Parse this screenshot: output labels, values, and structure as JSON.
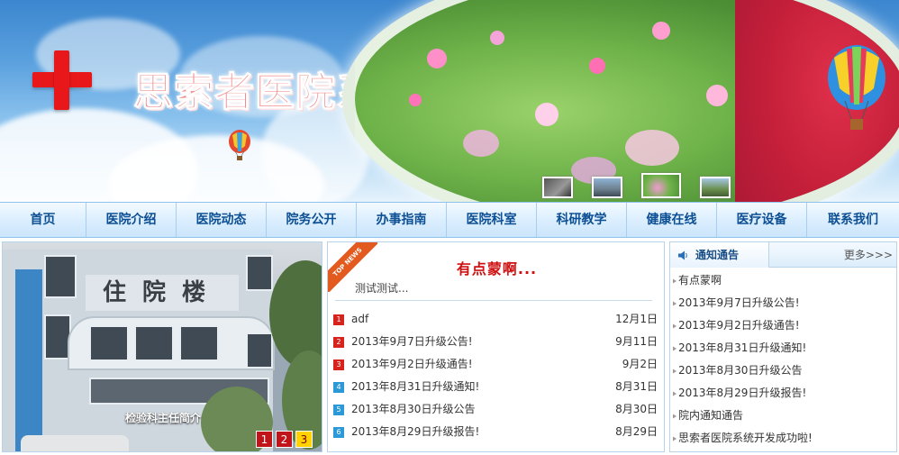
{
  "header": {
    "site_title": "思索者医院系统"
  },
  "nav": {
    "items": [
      "首页",
      "医院介绍",
      "医院动态",
      "院务公开",
      "办事指南",
      "医院科室",
      "科研教学",
      "健康在线",
      "医疗设备",
      "联系我们"
    ]
  },
  "slideshow": {
    "sign_text": "住院楼",
    "caption": "检验科主任简介",
    "pages": [
      "1",
      "2",
      "3"
    ],
    "active_page": 3
  },
  "news": {
    "badge": "TOP NEWS",
    "headline": "有点蒙啊...",
    "summary": "测试测试...",
    "items": [
      {
        "num": "1",
        "title": "adf",
        "date": "12月1日",
        "color": "red"
      },
      {
        "num": "2",
        "title": "2013年9月7日升级公告!",
        "date": "9月11日",
        "color": "red"
      },
      {
        "num": "3",
        "title": "2013年9月2日升级通告!",
        "date": "9月2日",
        "color": "red"
      },
      {
        "num": "4",
        "title": "2013年8月31日升级通知!",
        "date": "8月31日",
        "color": "blue"
      },
      {
        "num": "5",
        "title": "2013年8月30日升级公告",
        "date": "8月30日",
        "color": "blue"
      },
      {
        "num": "6",
        "title": "2013年8月29日升级报告!",
        "date": "8月29日",
        "color": "blue"
      }
    ]
  },
  "notices": {
    "title": "通知通告",
    "more": "更多>>>",
    "items": [
      "有点蒙啊",
      "2013年9月7日升级公告!",
      "2013年9月2日升级通告!",
      "2013年8月31日升级通知!",
      "2013年8月30日升级公告",
      "2013年8月29日升级报告!",
      "院内通知通告",
      "思索者医院系统开发成功啦!"
    ]
  },
  "colors": {
    "brand_red": "#e8171a",
    "nav_text": "#0d4f93",
    "headline_red": "#d01010",
    "page_badge_red": "#c0141a",
    "page_badge_active": "#ffd200"
  }
}
